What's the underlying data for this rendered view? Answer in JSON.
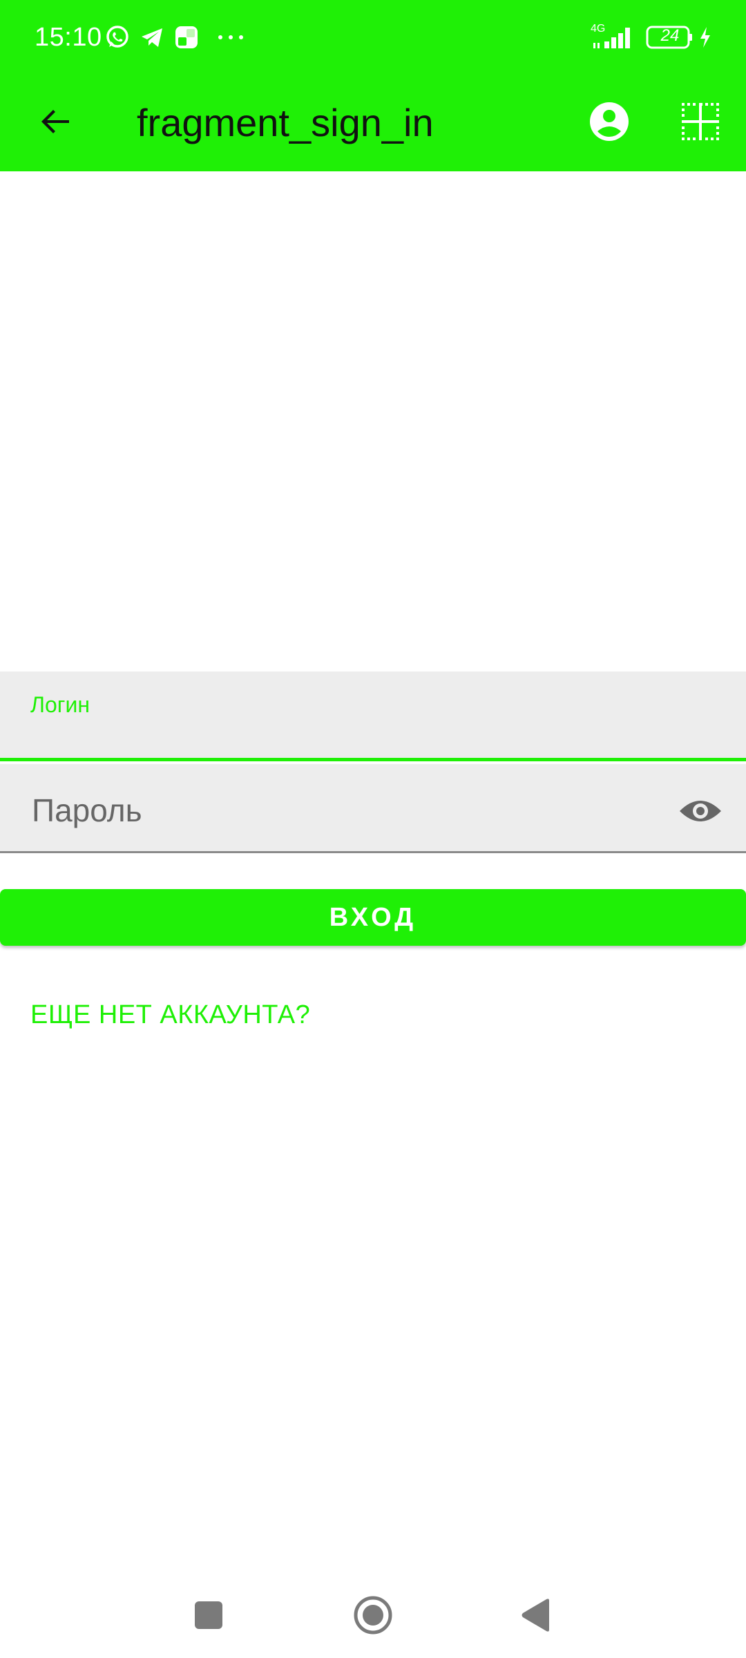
{
  "status_bar": {
    "time": "15:10",
    "network_type": "4G",
    "battery_level": "24",
    "icons": [
      "whatsapp-icon",
      "telegram-icon",
      "app-notification-icon",
      "more-notifications-icon",
      "signal-icon",
      "battery-icon",
      "charging-icon"
    ]
  },
  "app_bar": {
    "title": "fragment_sign_in",
    "icons": [
      "arrow-back-icon",
      "account-circle-icon",
      "grid-icon"
    ]
  },
  "form": {
    "login_label": "Логин",
    "login_value": "",
    "password_placeholder": "Пароль",
    "password_value": "",
    "submit_label": "ВХОД",
    "signup_link": "ЕЩЕ НЕТ АККАУНТА?"
  },
  "nav_bar": {
    "icons": [
      "recents-icon",
      "home-icon",
      "back-icon"
    ]
  },
  "colors": {
    "accent": "#1ff006",
    "field_background": "#ededed",
    "text_dark": "#111111",
    "text_hint": "#666666"
  }
}
